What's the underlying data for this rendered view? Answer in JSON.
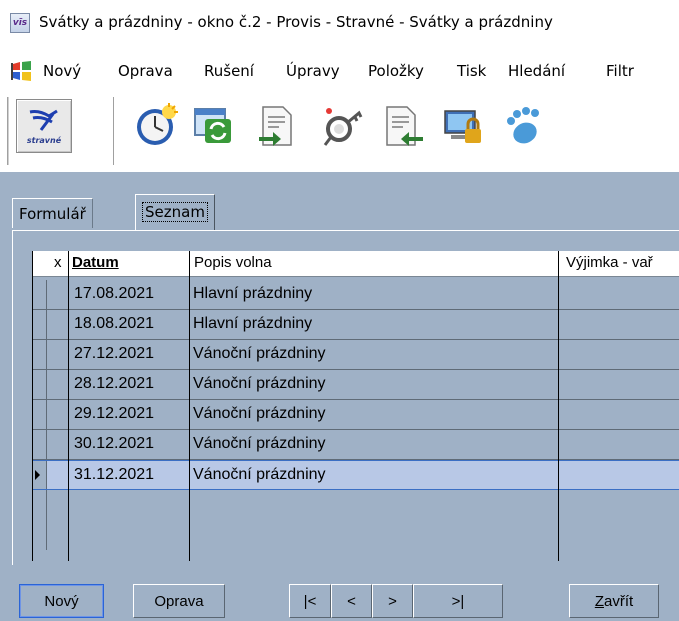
{
  "window": {
    "app_icon_text": "vīs",
    "title": "Svátky a prázdniny - okno č.2 - Provis - Stravné - Svátky a prázdniny"
  },
  "menu": {
    "items": [
      "Nový",
      "Oprava",
      "Rušení",
      "Úpravy",
      "Položky",
      "Tisk",
      "Hledání",
      "Filtr"
    ]
  },
  "toolbar": {
    "brand_label": "stravné",
    "buttons": [
      "clock-icon",
      "refresh-window-icon",
      "export-document-icon",
      "keys-icon",
      "import-document-icon",
      "lock-computer-icon",
      "footprint-icon"
    ]
  },
  "tabs": {
    "formular": "Formulář",
    "seznam": "Seznam"
  },
  "grid": {
    "headers": {
      "x": "x",
      "datum": "Datum",
      "popis": "Popis volna",
      "vyjimka": "Výjimka - vař"
    },
    "rows": [
      {
        "datum": "17.08.2021",
        "popis": "Hlavní prázdniny",
        "vyjimka": ""
      },
      {
        "datum": "18.08.2021",
        "popis": "Hlavní prázdniny",
        "vyjimka": ""
      },
      {
        "datum": "27.12.2021",
        "popis": "Vánoční prázdniny",
        "vyjimka": ""
      },
      {
        "datum": "28.12.2021",
        "popis": "Vánoční prázdniny",
        "vyjimka": ""
      },
      {
        "datum": "29.12.2021",
        "popis": "Vánoční prázdniny",
        "vyjimka": ""
      },
      {
        "datum": "30.12.2021",
        "popis": "Vánoční prázdniny",
        "vyjimka": ""
      },
      {
        "datum": "31.12.2021",
        "popis": "Vánoční prázdniny",
        "vyjimka": ""
      }
    ],
    "selected_row": 6
  },
  "buttons": {
    "novy": "Nový",
    "oprava": "Oprava",
    "first": "|<",
    "prev": "<",
    "next": ">",
    "last": ">|",
    "zavrit_prefix": "Z",
    "zavrit_rest": "avřít"
  },
  "colors": {
    "panel": "#9fb1c6",
    "selection": "#b8c8e6",
    "selection_border": "#3b6fc4"
  }
}
